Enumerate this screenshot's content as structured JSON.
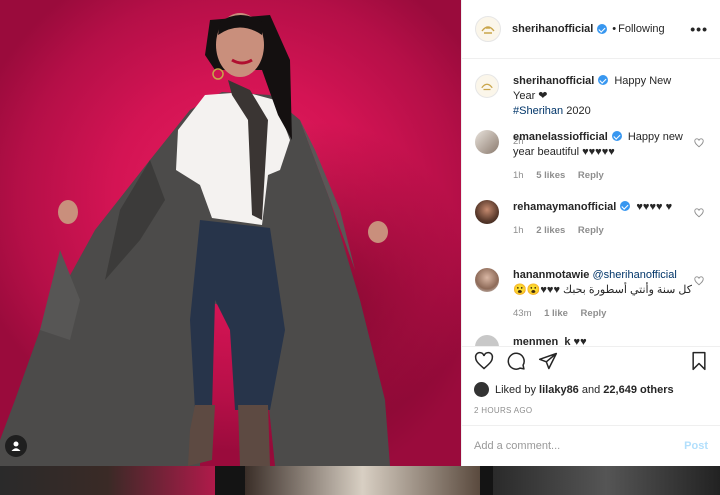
{
  "post": {
    "username": "sherihanofficial",
    "separator": "•",
    "follow_status": "Following",
    "more_label": "•••"
  },
  "caption": {
    "username": "sherihanofficial",
    "text": "Happy New Year ❤",
    "tag": "#Sherihan",
    "tag_suffix": " 2020",
    "time": "2h"
  },
  "comments": [
    {
      "username": "emanelassiofficial",
      "text": "Happy new year beautiful ♥♥♥♥♥",
      "time": "1h",
      "likes": "5 likes",
      "reply": "Reply"
    },
    {
      "username": "rehamaymanofficial",
      "text": "♥♥♥♥ ♥",
      "time": "1h",
      "likes": "2 likes",
      "reply": "Reply"
    },
    {
      "username": "hananmotawie",
      "mention": "@sherihanofficial",
      "text": "كل سنة وأنتي أسطورة بحبك ♥♥♥😮😮",
      "time": "43m",
      "likes": "1 like",
      "reply": "Reply"
    },
    {
      "username": "menmen_k",
      "text": "♥♥"
    }
  ],
  "likes": {
    "prefix": "Liked by",
    "user": "lilaky86",
    "joiner": "and",
    "count": "22,649 others"
  },
  "timestamp": "2 HOURS AGO",
  "add_comment": {
    "placeholder": "Add a comment...",
    "post_label": "Post"
  },
  "colors": {
    "verified": "#3897f0",
    "background": "#d41454",
    "post_disabled": "#b2dffc"
  }
}
